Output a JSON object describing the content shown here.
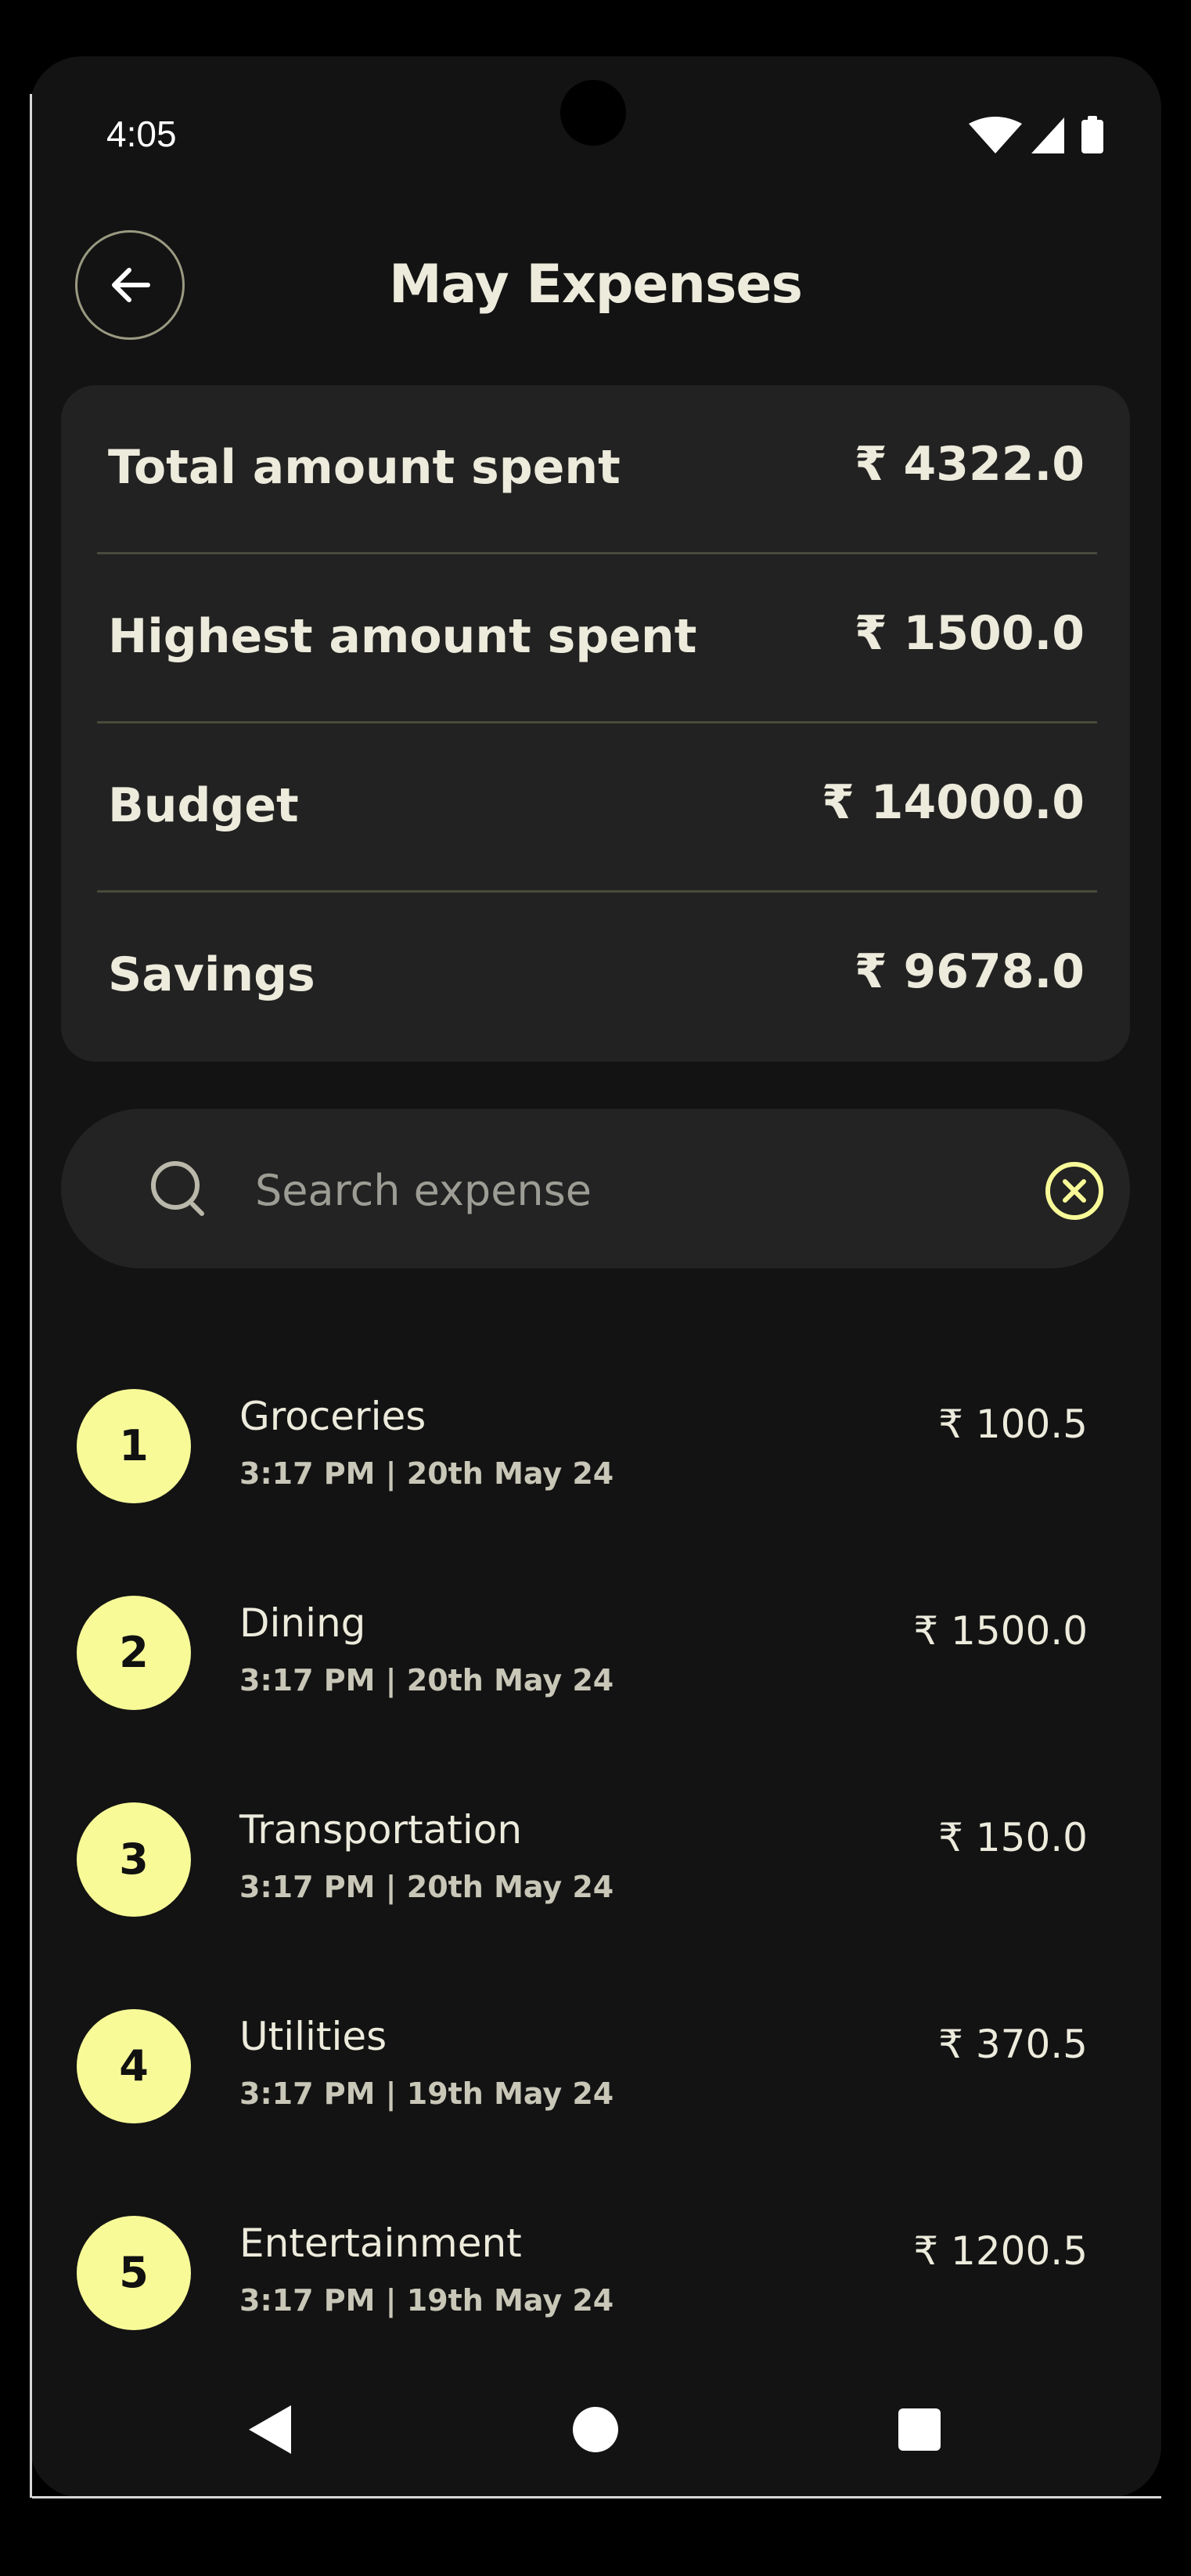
{
  "status_bar": {
    "time": "4:05",
    "icons": [
      "wifi-icon",
      "cellular-signal-icon",
      "battery-icon"
    ]
  },
  "header": {
    "title": "May Expenses",
    "back_icon": "arrow-left-icon"
  },
  "summary": [
    {
      "label": "Total amount spent",
      "value": "₹ 4322.0"
    },
    {
      "label": "Highest amount spent",
      "value": "₹ 1500.0"
    },
    {
      "label": "Budget",
      "value": "₹ 14000.0"
    },
    {
      "label": "Savings",
      "value": "₹ 9678.0"
    }
  ],
  "search": {
    "placeholder": "Search expense",
    "value": "",
    "icon": "search-icon",
    "clear_icon": "clear-circle-x-icon"
  },
  "expenses": [
    {
      "index": "1",
      "name": "Groceries",
      "time": "3:17 PM | 20th May 24",
      "amount": "₹ 100.5"
    },
    {
      "index": "2",
      "name": "Dining",
      "time": "3:17 PM | 20th May 24",
      "amount": "₹ 1500.0"
    },
    {
      "index": "3",
      "name": "Transportation",
      "time": "3:17 PM | 20th May 24",
      "amount": "₹ 150.0"
    },
    {
      "index": "4",
      "name": "Utilities",
      "time": "3:17 PM | 19th May 24",
      "amount": "₹ 370.5"
    },
    {
      "index": "5",
      "name": "Entertainment",
      "time": "3:17 PM | 19th May 24",
      "amount": "₹ 1200.5"
    }
  ],
  "colors": {
    "background": "#131313",
    "card": "#222222",
    "accent": "#f8fa98",
    "text": "#ecebdc"
  },
  "nav_bar": {
    "icons": [
      "nav-back-icon",
      "nav-home-icon",
      "nav-recents-icon"
    ]
  }
}
